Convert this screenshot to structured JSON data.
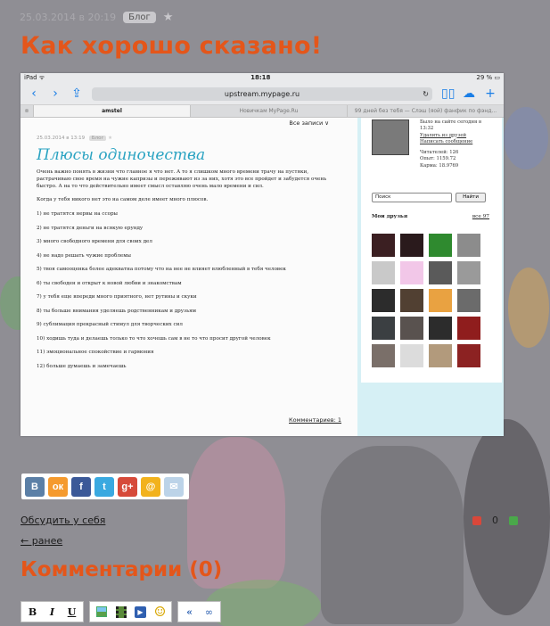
{
  "post": {
    "date": "25.03.2014 в 20:19",
    "tag": "Блог",
    "title": "Как хорошо сказано!"
  },
  "screenshot": {
    "status_left": "iPad ᯤ",
    "status_time": "18:18",
    "status_right": "29 % ▭",
    "url": "upstream.mypage.ru",
    "tabs": [
      "amstel",
      "Новичкам MyPage.Ru",
      "99 дней без тебя — Слэш (яой) фанфик по фэнд..."
    ],
    "all_posts": "Все записи ∨",
    "inner_date": "25.03.2014 в 13:19",
    "inner_tag": "Блог",
    "inner_title": "Плюсы одиночества",
    "intro": "Очень важно понять в жизни что главное я что нет. А то я слишком много времени трачу на пустяки, растрачиваю свое время на чужие капризы и переживают из за них, хотя это все пройдет и забудется очень быстро. А на то что действительно имеет смысл оставляю очень мало времени и сил.",
    "lead": "Когда у тебя никого нет это на самом деле имеет много плюсов.",
    "items": [
      "1) не тратятся нервы на ссоры",
      "2) не тратятся деньги на всякую ерунду",
      "3) много свободного времени для своих дел",
      "4) не надо решать чужие проблемы",
      "5) твоя самооценка более адекватна потому что на нее не влияет влюбленный в тебя человек",
      "6) ты свободен и открыт к новой любви и знакомствам",
      "7) у тебя еще впереди много приятного, нет рутины и скуки",
      "8) ты больше внимания уделяешь родственникам и друзьям",
      "9) сублимация прекрасный стимул для творческих сил",
      "10) ходишь туда и делаешь только то что хочешь сам в не то что просит другой человек",
      "11) эмоциональное спокойствие и гармония",
      "12) больше думаешь и замечаешь"
    ],
    "inner_comments": "Комментариев: 1",
    "profile_lines": [
      "Было на сайте сегодня в",
      "13:32",
      "Удалить из друзей",
      "Написать сообщение",
      "",
      "Читателей: 126",
      "Опыт: 1159.72",
      "Карма: 18.9769"
    ],
    "search_value": "Поиск",
    "search_button": "Найти",
    "friends_heading": "Мои друзья",
    "friends_all": "все 97",
    "friend_colors": [
      "#3b1f22",
      "#2a1a1c",
      "#2f8a2f",
      "#8c8c8c",
      "#c9c9c9",
      "#f2c7e8",
      "#5a5a5a",
      "#9a9a9a",
      "#2c2c2c",
      "#514032",
      "#e9a241",
      "#6b6b6b",
      "#3b3f42",
      "#59524f",
      "#2c2c2c",
      "#8f1d1d",
      "#7a6f69",
      "#dcdcdc",
      "#b29a7c",
      "#8c2222"
    ]
  },
  "share_buttons": [
    {
      "label": "В",
      "color": "#5b7fa6"
    },
    {
      "label": "ок",
      "color": "#f59a2e"
    },
    {
      "label": "f",
      "color": "#3b5998"
    },
    {
      "label": "t",
      "color": "#3aa9e0"
    },
    {
      "label": "g+",
      "color": "#d64a3a"
    },
    {
      "label": "@",
      "color": "#f2b21d"
    },
    {
      "label": "✉",
      "color": "#bcd3e8"
    }
  ],
  "discuss_link": "Обсудить у себя",
  "vote_count": "0",
  "prev_link": "← ранее",
  "comments_heading": "Комментарии (0)",
  "editor": {
    "bold": "B",
    "italic": "I",
    "underline": "U",
    "smile": "☺",
    "quote": "«",
    "link": "∞"
  }
}
